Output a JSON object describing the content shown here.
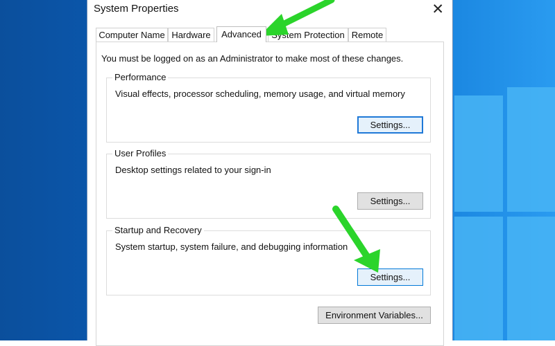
{
  "dialog": {
    "title": "System Properties",
    "close_glyph": "✕",
    "tabs": [
      {
        "label": "Computer Name"
      },
      {
        "label": "Hardware"
      },
      {
        "label": "Advanced"
      },
      {
        "label": "System Protection"
      },
      {
        "label": "Remote"
      }
    ],
    "active_tab": "Advanced",
    "notice": "You must be logged on as an Administrator to make most of these changes.",
    "groups": {
      "performance": {
        "title": "Performance",
        "description": "Visual effects, processor scheduling, memory usage, and virtual memory",
        "button": "Settings..."
      },
      "user_profiles": {
        "title": "User Profiles",
        "description": "Desktop settings related to your sign-in",
        "button": "Settings..."
      },
      "startup_recovery": {
        "title": "Startup and Recovery",
        "description": "System startup, system failure, and debugging information",
        "button": "Settings..."
      }
    },
    "env_button": "Environment Variables..."
  },
  "colors": {
    "annotation_arrow": "#2bd42b",
    "focus_border": "#1e78d7",
    "desktop_blue": "#0a62c2"
  }
}
